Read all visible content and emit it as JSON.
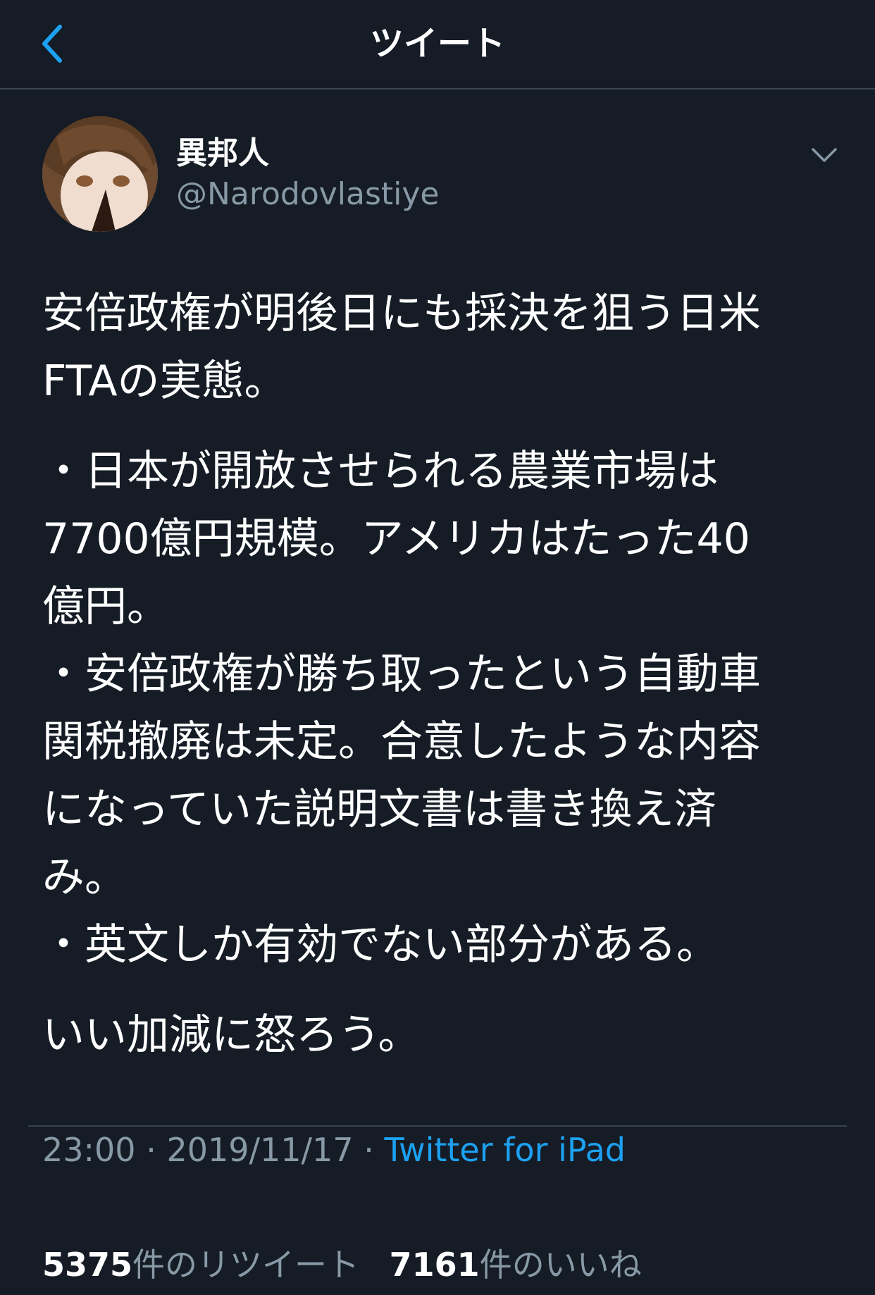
{
  "nav": {
    "title": "ツイート",
    "back_icon": "chevron-left-icon",
    "accent_color": "#1da1f2"
  },
  "tweet": {
    "display_name": "異邦人",
    "handle": "@Narodovlastiye",
    "menu_icon": "chevron-down-icon",
    "paragraphs": [
      [
        "安倍政権が明後日にも採決を狙う日米",
        "FTAの実態。"
      ],
      [
        "・日本が開放させられる農業市場は",
        "7700億円規模。アメリカはたった40",
        "億円。",
        "・安倍政権が勝ち取ったという自動車",
        "関税撤廃は未定。合意したような内容",
        "になっていた説明文書は書き換え済",
        "み。",
        "・英文しか有効でない部分がある。"
      ],
      [
        "いい加減に怒ろう。"
      ]
    ],
    "time": "23:00",
    "date": "2019/11/17",
    "separator": "·",
    "source": "Twitter for iPad"
  },
  "stats": {
    "retweets_count": "5375",
    "retweets_label": "件のリツイート",
    "likes_count": "7161",
    "likes_label": "件のいいね"
  },
  "colors": {
    "background": "#151c26",
    "text": "#ffffff",
    "secondary": "#8899a6",
    "divider": "#38444d",
    "link": "#1da1f2"
  }
}
